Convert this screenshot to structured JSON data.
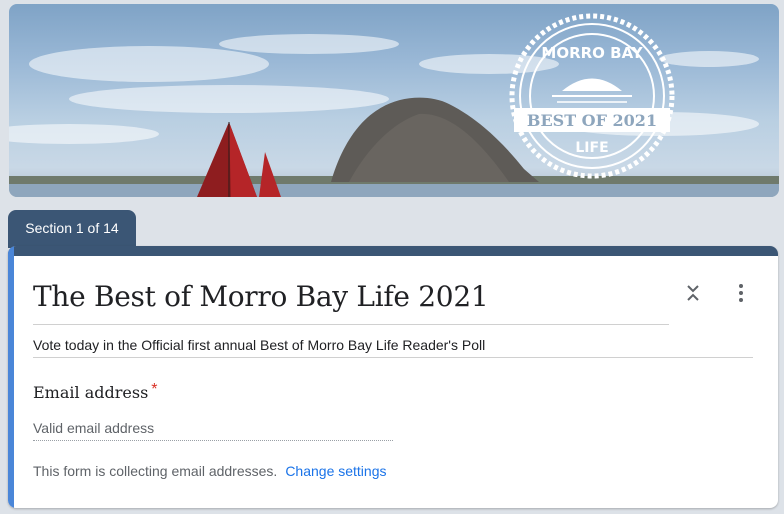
{
  "banner": {
    "badge_top": "MORRO BAY",
    "badge_mid": "BEST OF 2021",
    "badge_bottom": "LIFE"
  },
  "section_tab": {
    "label": "Section 1 of 14"
  },
  "form": {
    "title": "The Best of Morro Bay Life 2021",
    "description": "Vote today in the Official first annual Best of Morro Bay Life Reader's Poll",
    "email_label": "Email address",
    "required_mark": "*",
    "email_placeholder": "Valid email address",
    "collecting_note": "This form is collecting email addresses.",
    "change_settings_link": "Change settings"
  },
  "colors": {
    "header_navy": "#3b5675",
    "accent_blue": "#4a86d8",
    "link_blue": "#1a73e8",
    "required_red": "#d93025"
  },
  "icons": [
    "collapse-section-icon",
    "more-options-icon"
  ]
}
